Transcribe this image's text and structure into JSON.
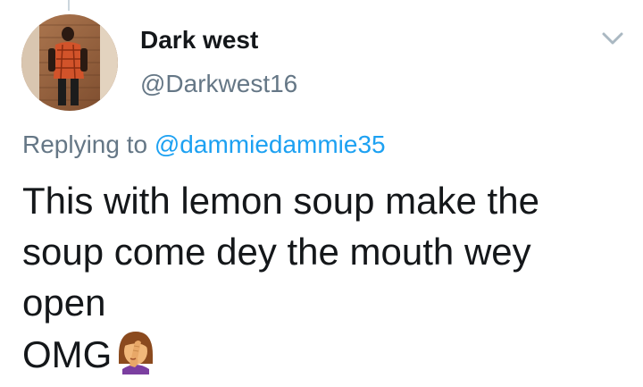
{
  "tweet": {
    "author": {
      "display_name": "Dark west",
      "handle": "@Darkwest16"
    },
    "reply": {
      "prefix": "Replying to",
      "mention": "@dammiedammie35"
    },
    "text_lines": [
      "This with lemon soup make the",
      "soup come dey the mouth wey",
      "open",
      "OMG"
    ],
    "emoji": "woman-facepalming-emoji",
    "menu_icon": "chevron-down-icon"
  },
  "colors": {
    "text_primary": "#14171a",
    "text_secondary": "#657786",
    "link": "#1da1f2",
    "thread_line": "#ccd6dd"
  }
}
